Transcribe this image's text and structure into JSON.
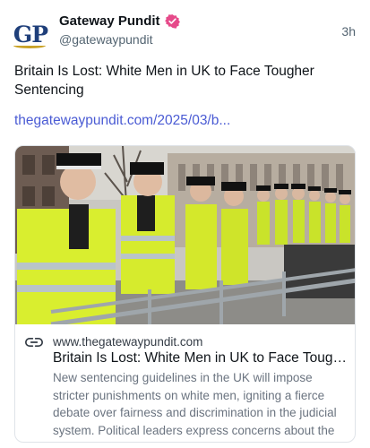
{
  "post": {
    "author": {
      "avatar_text_g": "G",
      "avatar_text_p": "P",
      "display_name": "Gateway Pundit",
      "handle": "@gatewaypundit",
      "verified_badge_color": "#e64a8a"
    },
    "timestamp": "3h",
    "text": "Britain Is Lost: White Men in UK to Face Tougher Sentencing",
    "link": "thegatewaypundit.com/2025/03/b...",
    "link_color": "#4a5bd4",
    "card": {
      "image_icon": "police-line-photo",
      "link_icon": "link-icon",
      "domain": "www.thegatewaypundit.com",
      "title": "Britain Is Lost: White Men in UK to Face Tough...",
      "description": "New sentencing guidelines in the UK will impose stricter punishments on white men, igniting a fierce debate over fairness and discrimination in the judicial system. Political leaders express concerns about the i..."
    }
  }
}
